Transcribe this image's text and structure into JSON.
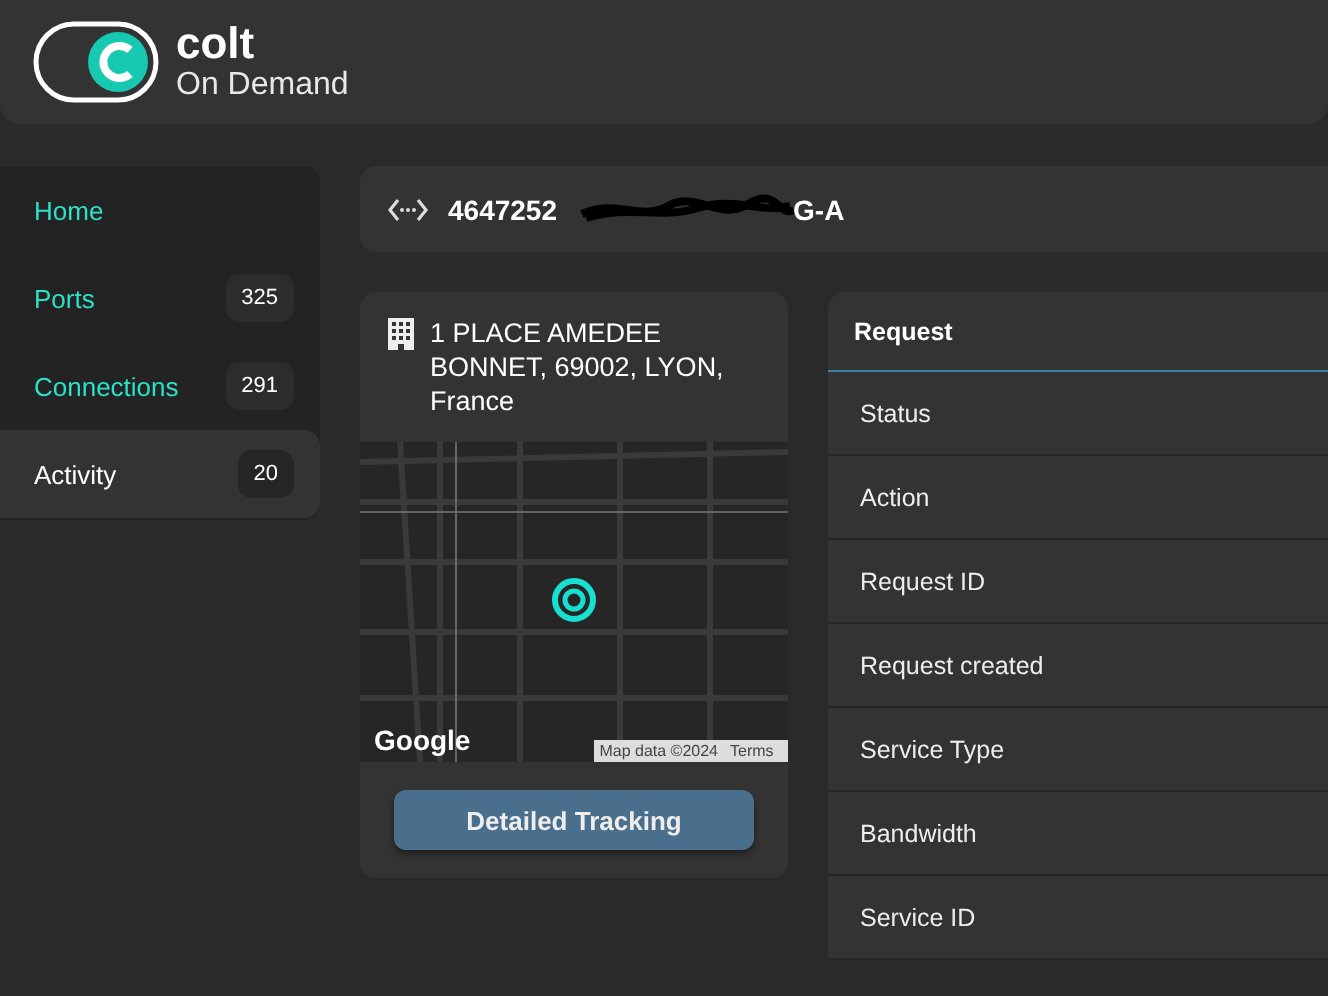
{
  "brand": {
    "name": "colt",
    "tagline": "On Demand"
  },
  "sidebar": {
    "items": [
      {
        "label": "Home",
        "selected": false
      },
      {
        "label": "Ports",
        "count": "325",
        "selected": false
      },
      {
        "label": "Connections",
        "count": "291",
        "selected": false
      },
      {
        "label": "Activity",
        "count": "20",
        "selected": true
      }
    ]
  },
  "connection": {
    "id": "4647252",
    "tail": "G-A"
  },
  "site_card": {
    "address": "1 PLACE AMEDEE BONNET, 69002, LYON, France",
    "map": {
      "logo": "Google",
      "attribution": "Map data ©2024",
      "terms": "Terms"
    },
    "button": "Detailed Tracking"
  },
  "request_panel": {
    "title": "Request",
    "rows": [
      "Status",
      "Action",
      "Request ID",
      "Request created",
      "Service Type",
      "Bandwidth",
      "Service ID"
    ]
  }
}
